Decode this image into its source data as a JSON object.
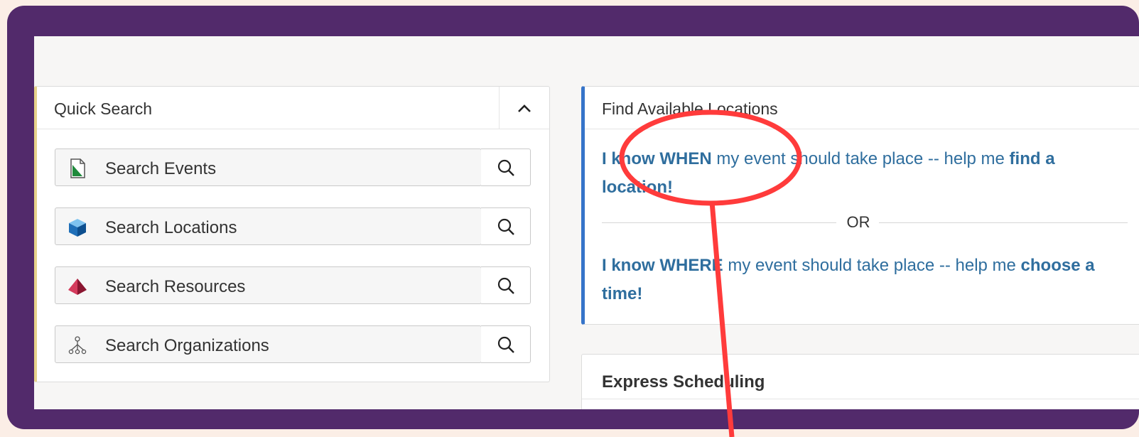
{
  "colors": {
    "frame": "#522a6b",
    "accent_yellow": "#e7d28a",
    "accent_blue": "#3674c9",
    "link": "#2f6e9e",
    "annotation": "#ff3b3b"
  },
  "quick_search": {
    "title": "Quick Search",
    "collapse_icon": "chevron-up-icon",
    "items": [
      {
        "label": "Search Events",
        "icon": "document-icon"
      },
      {
        "label": "Search Locations",
        "icon": "cube-icon"
      },
      {
        "label": "Search Resources",
        "icon": "pyramid-icon"
      },
      {
        "label": "Search Organizations",
        "icon": "org-chart-icon"
      }
    ]
  },
  "find_locations": {
    "title": "Find Available Locations",
    "when_link": {
      "bold_start": "I know WHEN",
      "middle": " my event should take place -- help me ",
      "bold_end": "find a location!"
    },
    "or_text": "OR",
    "where_link": {
      "bold_start": "I know WHERE",
      "middle": " my event should take place -- help me ",
      "bold_end": "choose a time!"
    }
  },
  "express_scheduling": {
    "title": "Express Scheduling"
  }
}
